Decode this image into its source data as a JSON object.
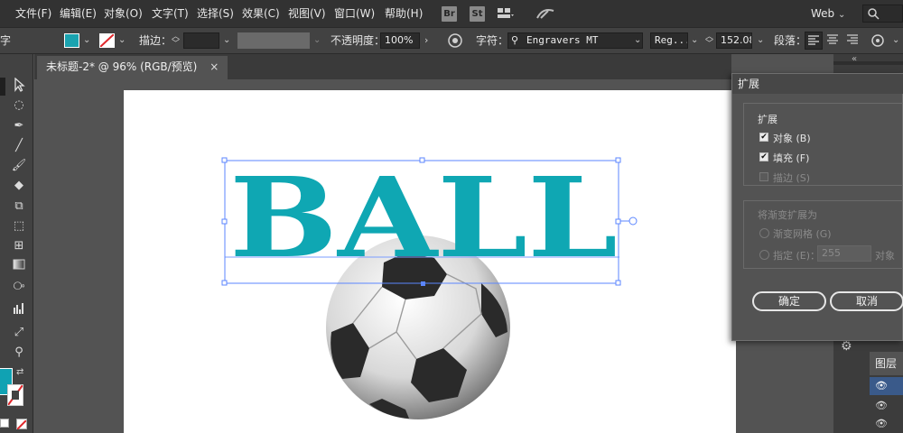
{
  "menu": {
    "items": [
      "文件(F)",
      "编辑(E)",
      "对象(O)",
      "文字(T)",
      "选择(S)",
      "效果(C)",
      "视图(V)",
      "窗口(W)",
      "帮助(H)"
    ],
    "bridge_label": "Br",
    "stock_label": "St",
    "workspace": "Web",
    "search_placeholder": ""
  },
  "control": {
    "left_label": "字",
    "stroke_label": "描边：",
    "opacity_label": "不透明度：",
    "opacity_value": "100%",
    "char_label": "字符：",
    "font_name": "Engravers MT",
    "font_style": "Reg...",
    "font_size": "152.08",
    "para_label": "段落：",
    "fill_color": "#1aa3b0"
  },
  "document": {
    "tab_title": "未标题-2* @ 96% (RGB/预览)",
    "tab_close": "×",
    "text_content": "BALL",
    "text_color": "#0fa7b3"
  },
  "dialog": {
    "title": "扩展",
    "section_expand": "扩展",
    "option_object": "对象 (B)",
    "option_object_checked": true,
    "option_fill": "填充 (F)",
    "option_fill_checked": true,
    "option_stroke": "描边 (S)",
    "option_stroke_checked": false,
    "section_gradient": "将渐变扩展为",
    "radio_mesh": "渐变网格 (G)",
    "radio_specify": "指定 (E)：",
    "specify_value": "255",
    "specify_unit": "对象",
    "ok_button": "确定",
    "cancel_button": "取消"
  },
  "layers": {
    "title": "图层"
  }
}
